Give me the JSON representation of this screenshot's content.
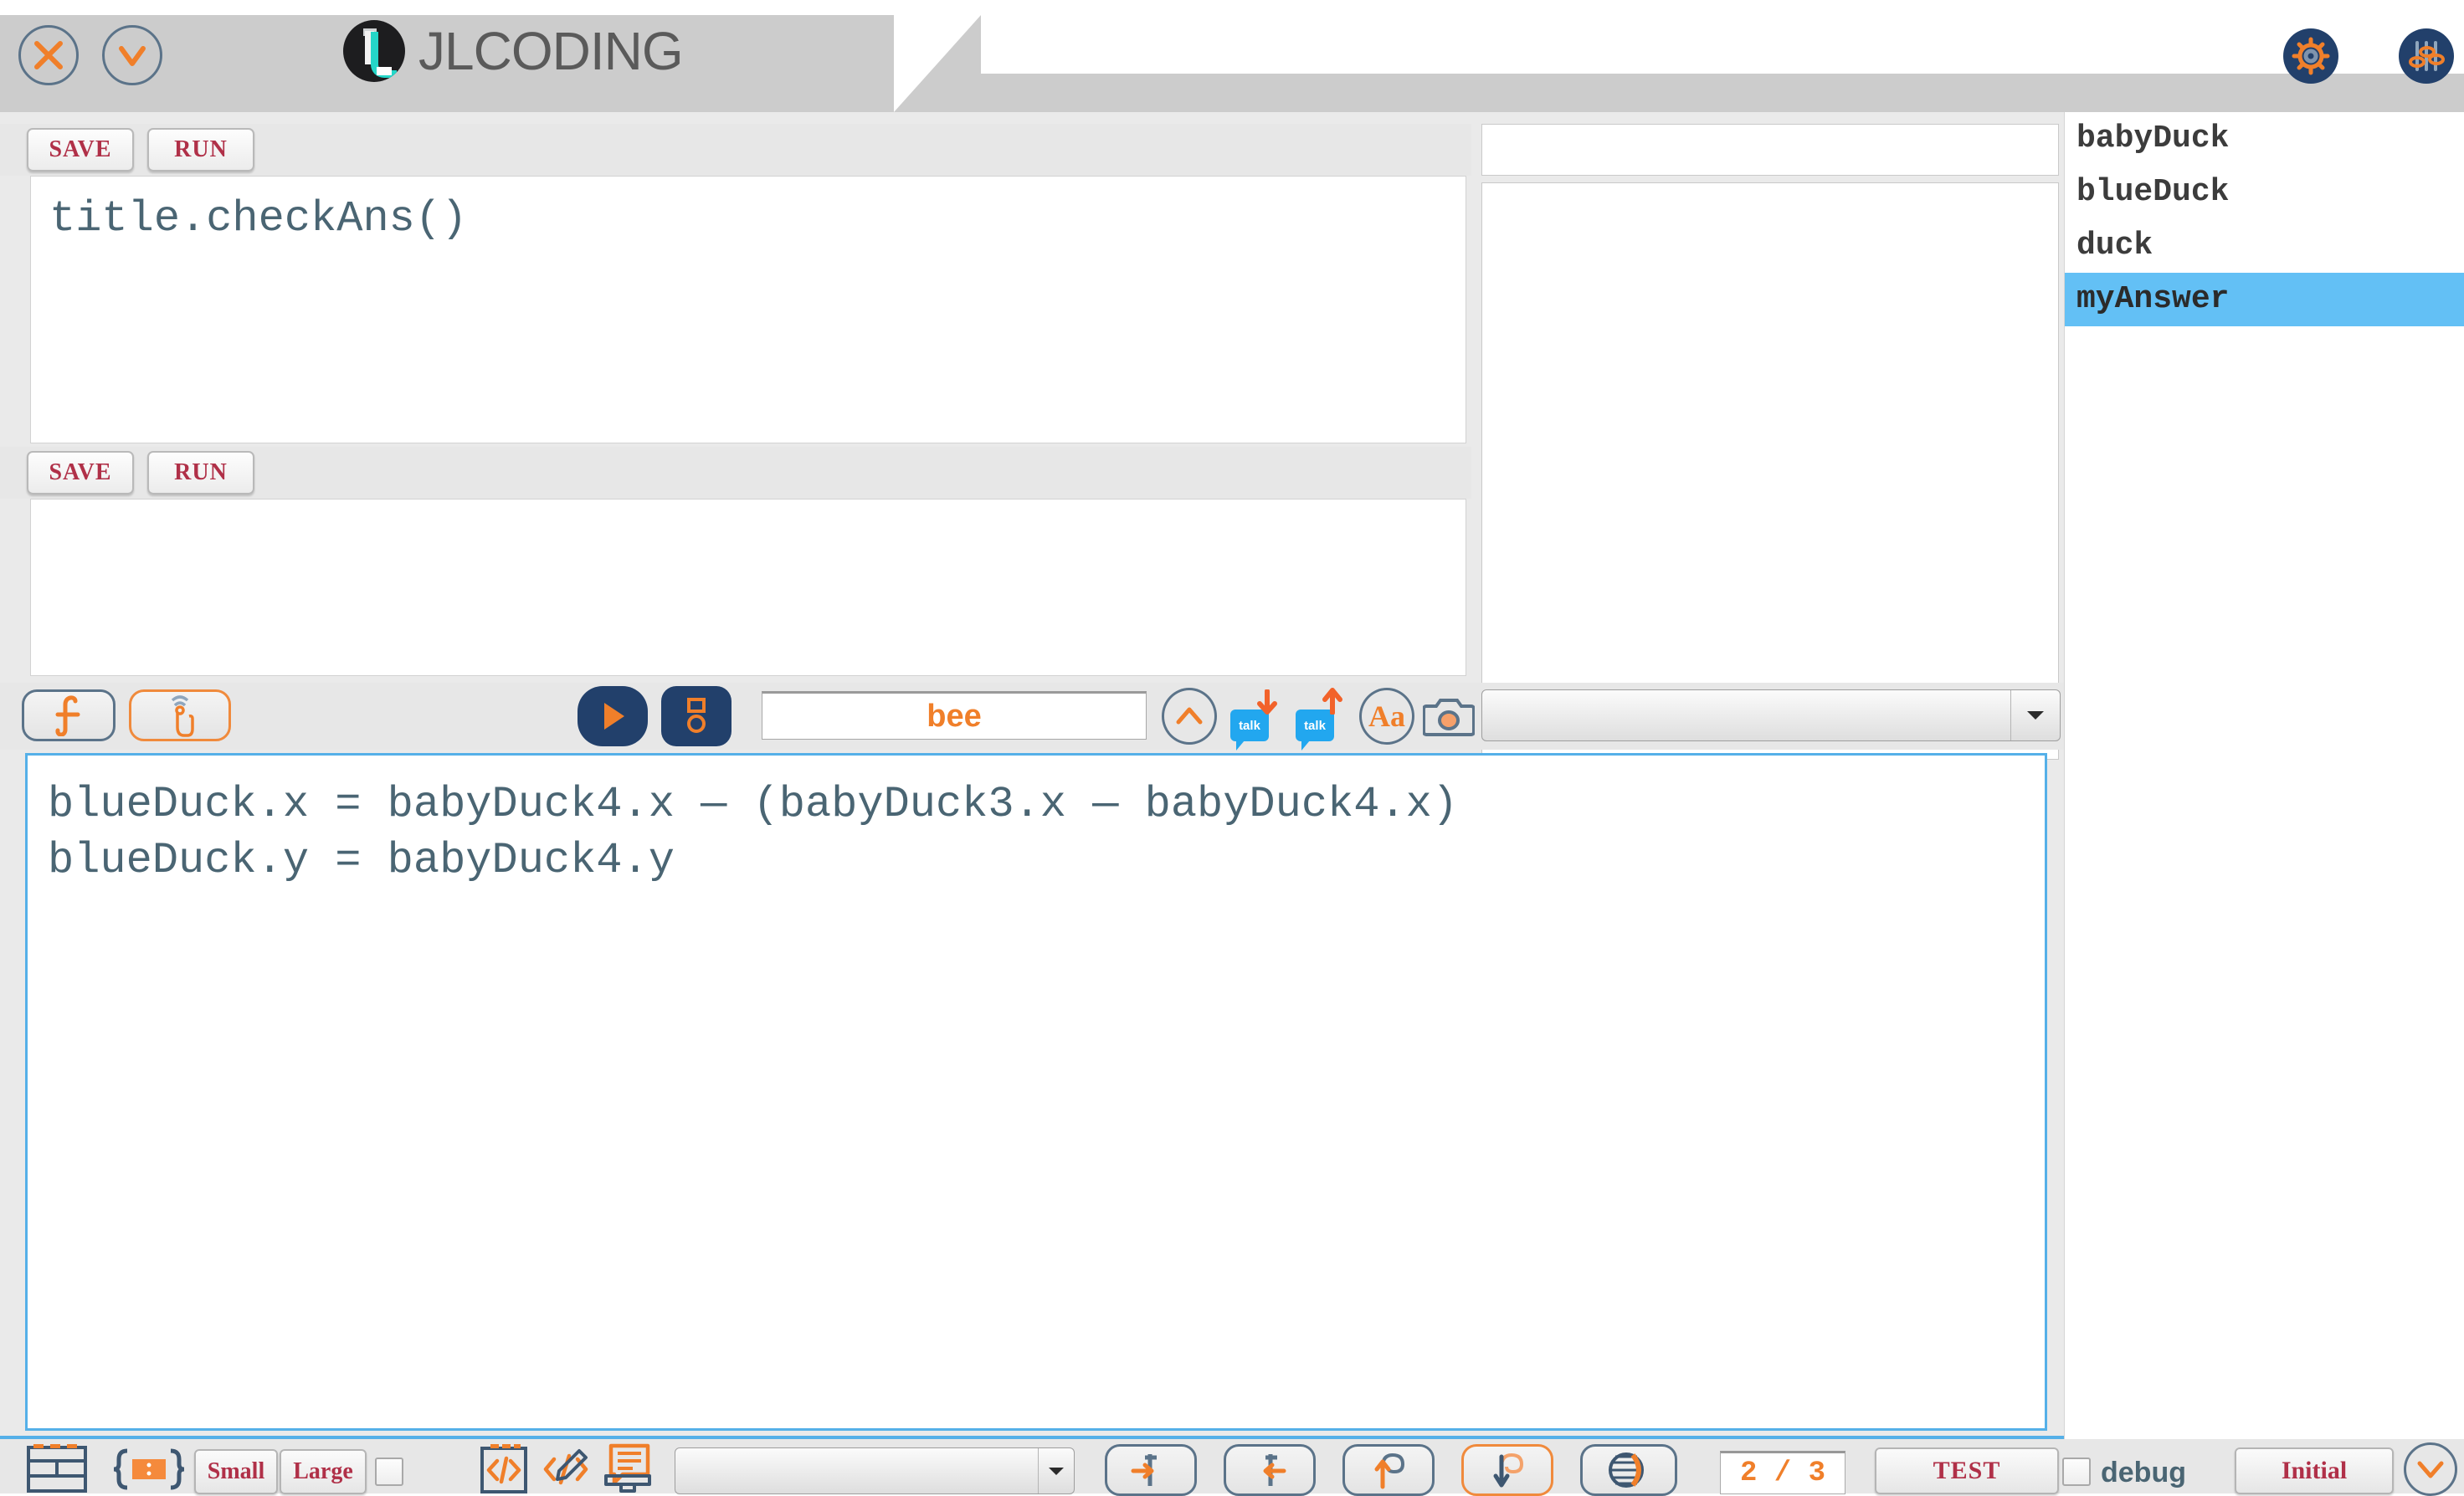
{
  "window": {
    "title": "JLCODING",
    "close_icon": "close-icon",
    "minimize_icon": "chevron-down-icon",
    "settings_icon": "gear-icon",
    "sliders_icon": "sliders-icon"
  },
  "editor_top": {
    "save_label": "SAVE",
    "run_label": "RUN",
    "code": "title.checkAns()"
  },
  "editor_bottom": {
    "save_label": "SAVE",
    "run_label": "RUN",
    "code": ""
  },
  "output_panel": {
    "top_text": "",
    "main_text": ""
  },
  "variables": {
    "items": [
      {
        "label": "babyDuck",
        "selected": false
      },
      {
        "label": "blueDuck",
        "selected": false
      },
      {
        "label": "duck",
        "selected": false
      },
      {
        "label": "myAnswer",
        "selected": true
      }
    ]
  },
  "mid_toolbar": {
    "function_icon": "function-f-icon",
    "touch_icon": "touch-hand-icon",
    "play_icon": "play-icon",
    "save_disk_icon": "floppy-disk-icon",
    "name_value": "bee",
    "collapse_icon": "chevron-up-icon",
    "talk_down_icon": "talk-download-icon",
    "talk_up_icon": "talk-upload-icon",
    "font_icon": "text-size-Aa-icon",
    "camera_icon": "camera-icon",
    "select_value": "",
    "select_arrow_icon": "chevron-down-icon"
  },
  "main_code": {
    "lines": [
      "blueDuck.x = babyDuck4.x — (babyDuck3.x — babyDuck4.x)",
      "blueDuck.y = babyDuck4.y"
    ]
  },
  "bottom_toolbar": {
    "table_icon": "table-layout-icon",
    "braces_icon": "curly-braces-icon",
    "small_label": "Small",
    "large_label": "Large",
    "size_checkbox_checked": false,
    "code_clipboard_icon": "code-clipboard-icon",
    "code_pen_icon": "code-pen-icon",
    "chat_book_icon": "chat-book-icon",
    "select_value": "",
    "select_arrow_icon": "chevron-down-icon",
    "step_in_icon": "arrow-right-in-icon",
    "step_out_icon": "arrow-left-out-icon",
    "upload_pin_icon": "upload-pin-icon",
    "download_pin_icon": "download-pin-icon",
    "contrast_icon": "contrast-theme-icon",
    "page_indicator": "2 / 3",
    "test_label": "TEST",
    "debug_label": "debug",
    "debug_checked": false,
    "initial_label": "Initial",
    "expand_icon": "chevron-down-icon"
  },
  "colors": {
    "accent_orange": "#f07f2a",
    "navy": "#22406b",
    "crimson": "#b03048",
    "selection_blue": "#63c0f5",
    "border_blue": "#55b0e8",
    "code_text": "#4a6573"
  }
}
